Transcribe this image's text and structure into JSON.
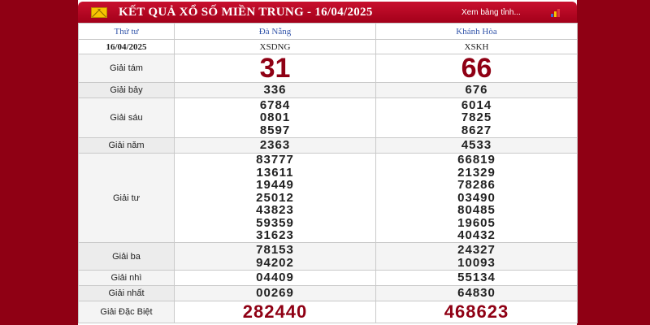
{
  "header": {
    "title": "KẾT QUẢ XỔ SỐ MIỀN TRUNG - 16/04/2025",
    "view_link": "Xem bảng tỉnh..."
  },
  "columns": {
    "day": "Thứ tư",
    "date": "16/04/2025",
    "provinces": [
      {
        "name": "Đà Nẵng",
        "code": "XSDNG"
      },
      {
        "name": "Khánh Hòa",
        "code": "XSKH"
      }
    ]
  },
  "prizes": [
    {
      "label": "Giải tám",
      "values": [
        [
          "31"
        ],
        [
          "66"
        ]
      ]
    },
    {
      "label": "Giải bảy",
      "values": [
        [
          "336"
        ],
        [
          "676"
        ]
      ]
    },
    {
      "label": "Giải sáu",
      "values": [
        [
          "6784",
          "0801",
          "8597"
        ],
        [
          "6014",
          "7825",
          "8627"
        ]
      ]
    },
    {
      "label": "Giải năm",
      "values": [
        [
          "2363"
        ],
        [
          "4533"
        ]
      ]
    },
    {
      "label": "Giải tư",
      "values": [
        [
          "83777",
          "13611",
          "19449",
          "25012",
          "43823",
          "59359",
          "31623"
        ],
        [
          "66819",
          "21329",
          "78286",
          "03490",
          "80485",
          "19605",
          "40432"
        ]
      ]
    },
    {
      "label": "Giải ba",
      "values": [
        [
          "78153",
          "94202"
        ],
        [
          "24327",
          "10093"
        ]
      ]
    },
    {
      "label": "Giải nhì",
      "values": [
        [
          "04409"
        ],
        [
          "55134"
        ]
      ]
    },
    {
      "label": "Giải nhất",
      "values": [
        [
          "00269"
        ],
        [
          "64830"
        ]
      ]
    },
    {
      "label": "Giải Đặc Biệt",
      "values": [
        [
          "282440"
        ],
        [
          "468623"
        ]
      ]
    }
  ],
  "colors": {
    "brand_red": "#8f0014",
    "header_red": "#c8102e",
    "province_blue": "#3355aa"
  },
  "icons": [
    "mail-icon",
    "chart-icon"
  ]
}
